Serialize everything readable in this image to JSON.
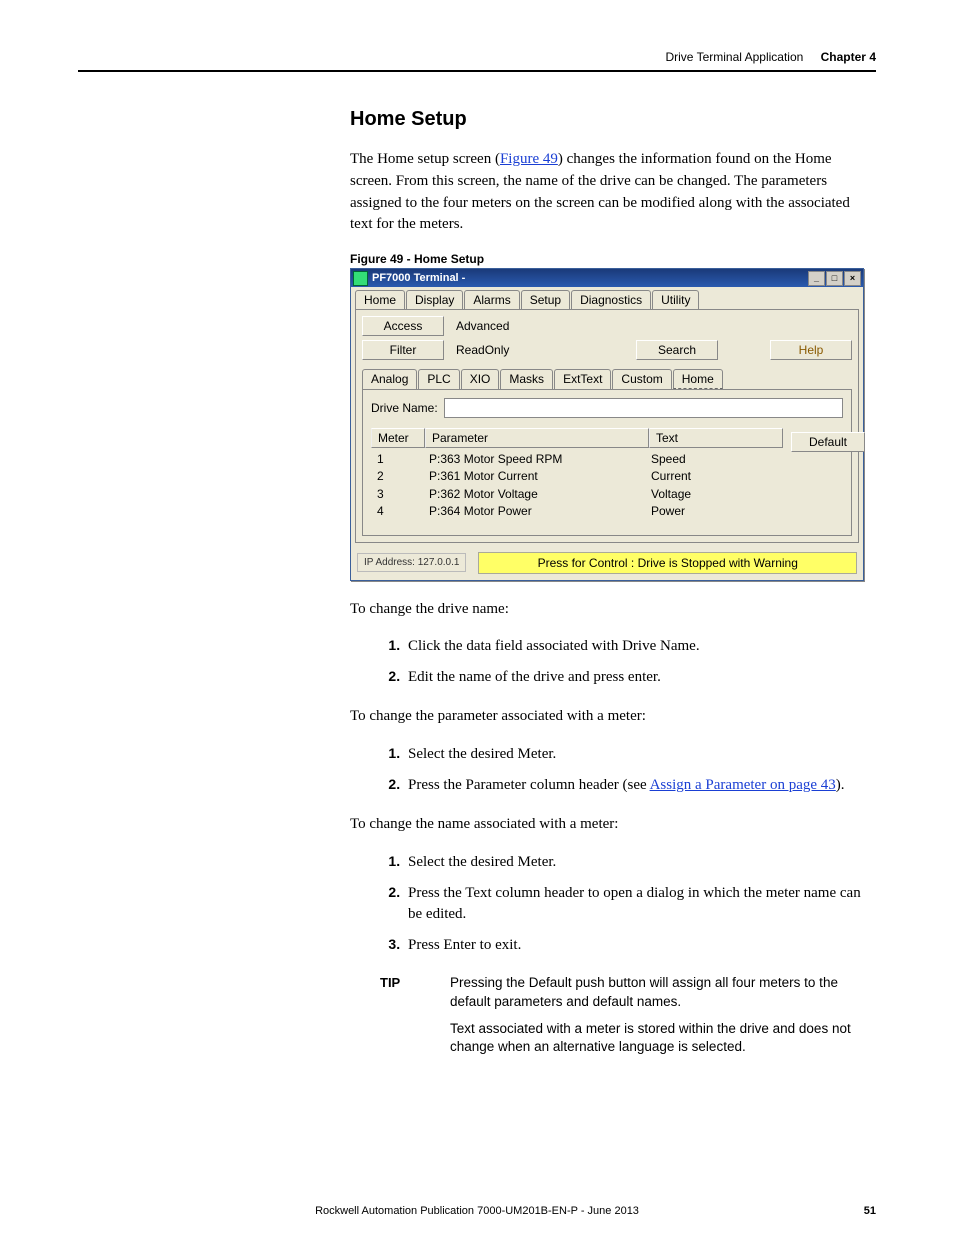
{
  "header": {
    "chapter_name": "Drive Terminal Application",
    "chapter_num": "Chapter 4"
  },
  "section_title": "Home Setup",
  "intro_pre": "The Home setup screen (",
  "intro_link": "Figure 49",
  "intro_post": ") changes the information found on the Home screen. From this screen, the name of the drive can be changed. The parameters assigned to the four meters on the screen can be modified along with the associated text for the meters.",
  "fig_caption": "Figure 49 - Home Setup",
  "shot": {
    "title": "PF7000 Terminal -",
    "winbtns": [
      "_",
      "□",
      "×"
    ],
    "maintabs": [
      "Home",
      "Display",
      "Alarms",
      "Setup",
      "Diagnostics",
      "Utility"
    ],
    "access_label": "Access",
    "access_value": "Advanced",
    "filter_label": "Filter",
    "filter_value": "ReadOnly",
    "search_label": "Search",
    "help_label": "Help",
    "subtabs": [
      "Analog",
      "PLC",
      "XIO",
      "Masks",
      "ExtText",
      "Custom",
      "Home"
    ],
    "drive_name_label": "Drive Name:",
    "tbl_heads": [
      "Meter",
      "Parameter",
      "Text"
    ],
    "rows": [
      {
        "m": "1",
        "p": "P:363 Motor Speed RPM",
        "t": "Speed"
      },
      {
        "m": "2",
        "p": "P:361 Motor Current",
        "t": "Current"
      },
      {
        "m": "3",
        "p": "P:362 Motor Voltage",
        "t": "Voltage"
      },
      {
        "m": "4",
        "p": "P:364 Motor Power",
        "t": "Power"
      }
    ],
    "default_btn": "Default",
    "ip": "IP Address: 127.0.0.1",
    "status": "Press for Control : Drive is Stopped with Warning"
  },
  "p_change_drive": "To change the drive name:",
  "list1": [
    "Click the data field associated with Drive Name.",
    "Edit the name of the drive and press enter."
  ],
  "p_change_param": "To change the parameter associated with a meter:",
  "list2_item1": "Select the desired Meter.",
  "list2_item2_pre": "Press the Parameter column header (see ",
  "list2_item2_link": "Assign a Parameter on page 43",
  "list2_item2_post": ").",
  "p_change_name": "To change the name associated with a meter:",
  "list3": [
    "Select the desired Meter.",
    "Press the Text column header to open a dialog in which the meter name can be edited.",
    "Press Enter to exit."
  ],
  "tip_label": "TIP",
  "tip1": "Pressing the Default push button will assign all four meters to the default parameters and default names.",
  "tip2": "Text associated with a meter is stored within the drive and does not change when an alternative language is selected.",
  "footer_pub": "Rockwell Automation Publication 7000-UM201B-EN-P - June 2013",
  "footer_page": "51"
}
